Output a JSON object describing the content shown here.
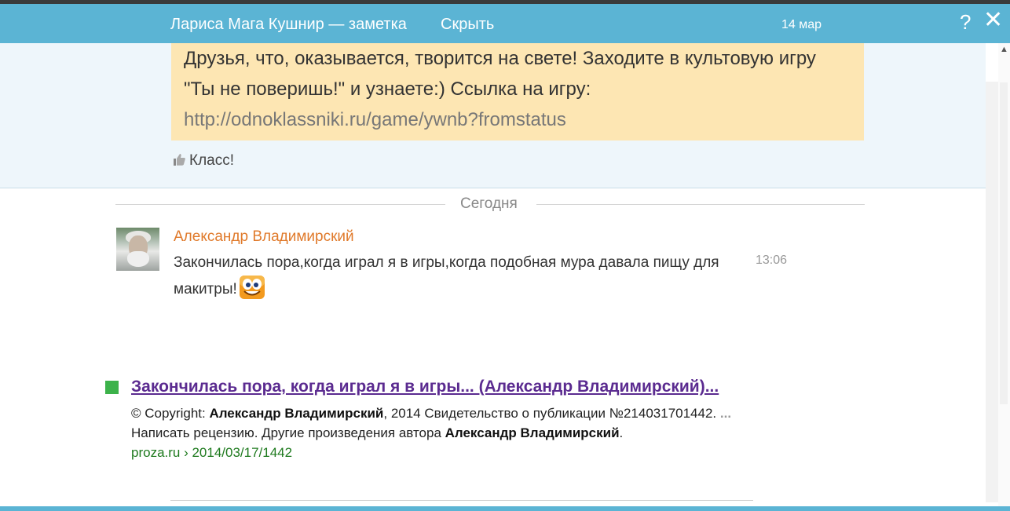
{
  "header": {
    "title": "Лариса Мага Кушнир — заметка",
    "hide_label": "Скрыть",
    "date": "14 мар",
    "help_icon": "?",
    "close_icon": "✕"
  },
  "note": {
    "text": "Друзья, что, оказывается, творится на свете! Заходите в культовую игру \"Ты не поверишь!\" и узнаете:) Ссылка на игру:",
    "link": "http://odnoklassniki.ru/game/ywnb?fromstatus",
    "like_label": "Класс!"
  },
  "divider": {
    "label": "Сегодня"
  },
  "comment": {
    "author": "Александр Владимирский",
    "text": "Закончилась пора,когда играл я в игры,когда подобная мура давала пищу для макитры!",
    "time": "13:06",
    "emoji": "smiley-face"
  },
  "search_result": {
    "title": "Закончилась пора, когда играл я в игры... (Александр Владимирский)...",
    "snippet_1_prefix": "© Copyright: ",
    "snippet_1_bold": "Александр Владимирский",
    "snippet_1_suffix": ", 2014 Свидетельство о публикации №214031701442.",
    "snippet_1_ellipsis": "...",
    "snippet_2_prefix": "Написать рецензию. Другие произведения автора ",
    "snippet_2_bold": "Александр Владимирский",
    "snippet_2_suffix": ".",
    "url": "proza.ru › 2014/03/17/1442"
  },
  "colors": {
    "header_bg": "#5bb4d4",
    "note_bg": "#fde6b3",
    "author": "#e07a2b",
    "result_title": "#5b2b90",
    "result_url": "#1e7a1e"
  }
}
